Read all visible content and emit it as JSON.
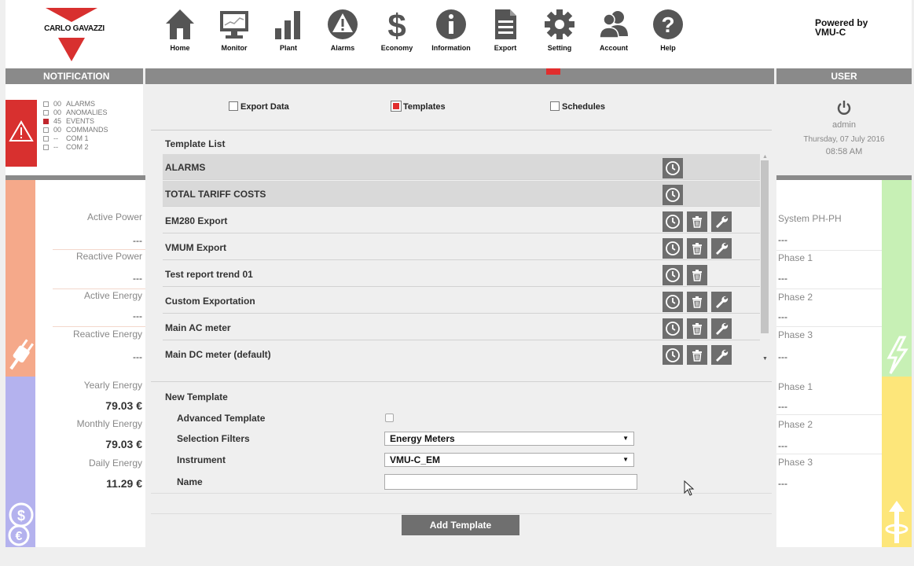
{
  "brand": {
    "name": "CARLO GAVAZZI",
    "color": "#d8302f"
  },
  "nav": [
    {
      "label": "Home",
      "icon": "home-icon"
    },
    {
      "label": "Monitor",
      "icon": "monitor-icon"
    },
    {
      "label": "Plant",
      "icon": "plant-bars-icon"
    },
    {
      "label": "Alarms",
      "icon": "alarm-warning-icon"
    },
    {
      "label": "Economy",
      "icon": "dollar-icon"
    },
    {
      "label": "Information",
      "icon": "info-icon"
    },
    {
      "label": "Export",
      "icon": "document-export-icon"
    },
    {
      "label": "Setting",
      "icon": "gear-icon"
    },
    {
      "label": "Account",
      "icon": "users-icon"
    },
    {
      "label": "Help",
      "icon": "question-icon"
    }
  ],
  "powered_by": "Powered by\nVMU-C",
  "bars": {
    "notification": "NOTIFICATION",
    "user": "USER"
  },
  "notifications": [
    {
      "count": "00",
      "label": "ALARMS",
      "active": false
    },
    {
      "count": "00",
      "label": "ANOMALIES",
      "active": false
    },
    {
      "count": "45",
      "label": "EVENTS",
      "active": true
    },
    {
      "count": "00",
      "label": "COMMANDS",
      "active": false
    },
    {
      "count": "--",
      "label": "COM 1",
      "active": false
    },
    {
      "count": "--",
      "label": "COM 2",
      "active": false
    }
  ],
  "left_power": {
    "active_power_label": "Active Power",
    "active_power_value": "---",
    "reactive_power_label": "Reactive Power",
    "reactive_power_value": "---",
    "active_energy_label": "Active Energy",
    "active_energy_value": "---",
    "reactive_energy_label": "Reactive Energy",
    "reactive_energy_value": "---"
  },
  "left_energy": {
    "yearly_label": "Yearly Energy",
    "yearly_value": "79.03 €",
    "monthly_label": "Monthly Energy",
    "monthly_value": "79.03 €",
    "daily_label": "Daily Energy",
    "daily_value": "11.29 €"
  },
  "tabs": {
    "export_data": "Export Data",
    "templates": "Templates",
    "schedules": "Schedules",
    "active": "templates"
  },
  "template_list": {
    "title": "Template List",
    "rows": [
      {
        "name": "ALARMS",
        "system": true,
        "delete": false,
        "edit": false
      },
      {
        "name": "TOTAL TARIFF COSTS",
        "system": true,
        "delete": false,
        "edit": false
      },
      {
        "name": "EM280 Export",
        "system": false,
        "delete": true,
        "edit": true
      },
      {
        "name": "VMUM Export",
        "system": false,
        "delete": true,
        "edit": true
      },
      {
        "name": "Test report trend 01",
        "system": false,
        "delete": true,
        "edit": false
      },
      {
        "name": "Custom Exportation",
        "system": false,
        "delete": true,
        "edit": true
      },
      {
        "name": "Main AC meter",
        "system": false,
        "delete": true,
        "edit": true
      },
      {
        "name": "Main DC meter (default)",
        "system": false,
        "delete": true,
        "edit": true
      }
    ]
  },
  "new_template": {
    "title": "New Template",
    "advanced_label": "Advanced Template",
    "advanced_checked": false,
    "filters_label": "Selection Filters",
    "filters_value": "Energy Meters",
    "instrument_label": "Instrument",
    "instrument_value": "VMU-C_EM",
    "name_label": "Name",
    "name_value": "",
    "add_button": "Add Template"
  },
  "user": {
    "name": "admin",
    "date": "Thursday, 07 July 2016",
    "time": "08:58 AM"
  },
  "right_voltage": {
    "system_label": "System PH-PH",
    "system_value": "---",
    "p1_label": "Phase 1",
    "p1_value": "---",
    "p2_label": "Phase 2",
    "p2_value": "---",
    "p3_label": "Phase 3",
    "p3_value": "---"
  },
  "right_current": {
    "p1_label": "Phase 1",
    "p1_value": "---",
    "p2_label": "Phase 2",
    "p2_value": "---",
    "p3_label": "Phase 3",
    "p3_value": "---"
  },
  "colors": {
    "bar_gray": "#8a8a8a",
    "power_band": "#f5a98a",
    "energy_band": "#b4b2ee",
    "voltage_band": "#c7f0b5",
    "current_band": "#fde67a",
    "active_red": "#e12d2d"
  }
}
